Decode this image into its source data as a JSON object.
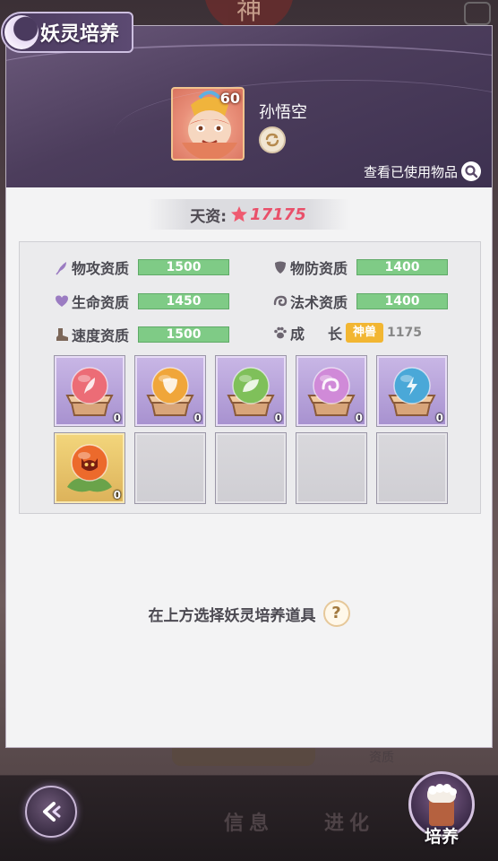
{
  "backdrop": {
    "emblem_char": "神",
    "tab_info": "信息",
    "tab_advance": "进化",
    "label_behind": "资质"
  },
  "nav": {
    "cultivate_label": "培养"
  },
  "panel": {
    "title": "妖灵培养",
    "pet": {
      "name": "孙悟空",
      "level": "60"
    },
    "view_used_label": "查看已使用物品",
    "talent": {
      "label": "天资:",
      "value": "17175"
    },
    "stats": [
      {
        "label": "物攻资质",
        "value": "1500",
        "icon": "feather-icon"
      },
      {
        "label": "物防资质",
        "value": "1400",
        "icon": "shield-icon"
      },
      {
        "label": "生命资质",
        "value": "1450",
        "icon": "heart-icon"
      },
      {
        "label": "法术资质",
        "value": "1400",
        "icon": "swirl-icon"
      },
      {
        "label": "速度资质",
        "value": "1500",
        "icon": "boot-icon"
      }
    ],
    "growth": {
      "label_a": "成",
      "label_b": "长",
      "badge": "神兽",
      "value": "1175",
      "icon": "paw-icon"
    },
    "items": [
      {
        "orb": "#ec6c76",
        "symbol": "feather",
        "count": "0"
      },
      {
        "orb": "#f0a63a",
        "symbol": "shield",
        "count": "0"
      },
      {
        "orb": "#7fc05a",
        "symbol": "leaf",
        "count": "0"
      },
      {
        "orb": "#d08ad8",
        "symbol": "swirl",
        "count": "0"
      },
      {
        "orb": "#4aa8d8",
        "symbol": "bolt",
        "count": "0"
      },
      {
        "orb": "#ec6a2c",
        "symbol": "devil",
        "count": "0"
      }
    ],
    "hint": "在上方选择妖灵培养道具",
    "help_label": "?"
  },
  "colors": {
    "stat_bar": "#7fcb86",
    "talent_value": "#e9506a",
    "growth_badge": "#f2b632"
  }
}
